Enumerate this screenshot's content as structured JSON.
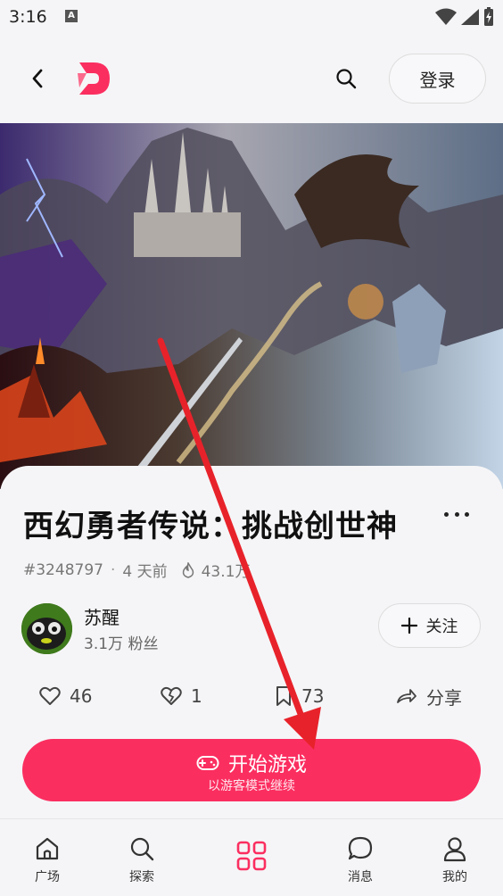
{
  "status_bar": {
    "time": "3:16",
    "notif_badge": "A"
  },
  "header": {
    "back_icon": "chevron-left-icon",
    "logo_icon": "brand-d-logo-icon",
    "search_icon": "search-icon",
    "login_label": "登录"
  },
  "hero": {
    "image_alt": "fantasy-landscape-artwork"
  },
  "game": {
    "title": "西幻勇者传说：挑战创世神",
    "id": "#3248797",
    "time": "4 天前",
    "heat": "43.1万"
  },
  "author": {
    "name": "苏醒",
    "fans": "3.1万 粉丝",
    "follow_label": "关注"
  },
  "actions": {
    "likes": "46",
    "dislikes": "1",
    "bookmarks": "73",
    "share_label": "分享"
  },
  "start_button": {
    "label": "开始游戏",
    "sublabel": "以游客模式继续"
  },
  "bottom_nav": {
    "items": [
      {
        "label": "广场",
        "icon": "home-icon"
      },
      {
        "label": "探索",
        "icon": "search-icon"
      },
      {
        "label": "",
        "icon": "grid-icon"
      },
      {
        "label": "消息",
        "icon": "chat-icon"
      },
      {
        "label": "我的",
        "icon": "user-icon"
      }
    ]
  },
  "colors": {
    "accent": "#fb2e60",
    "background": "#f5f5f7",
    "annotation_arrow": "#e8222a"
  }
}
